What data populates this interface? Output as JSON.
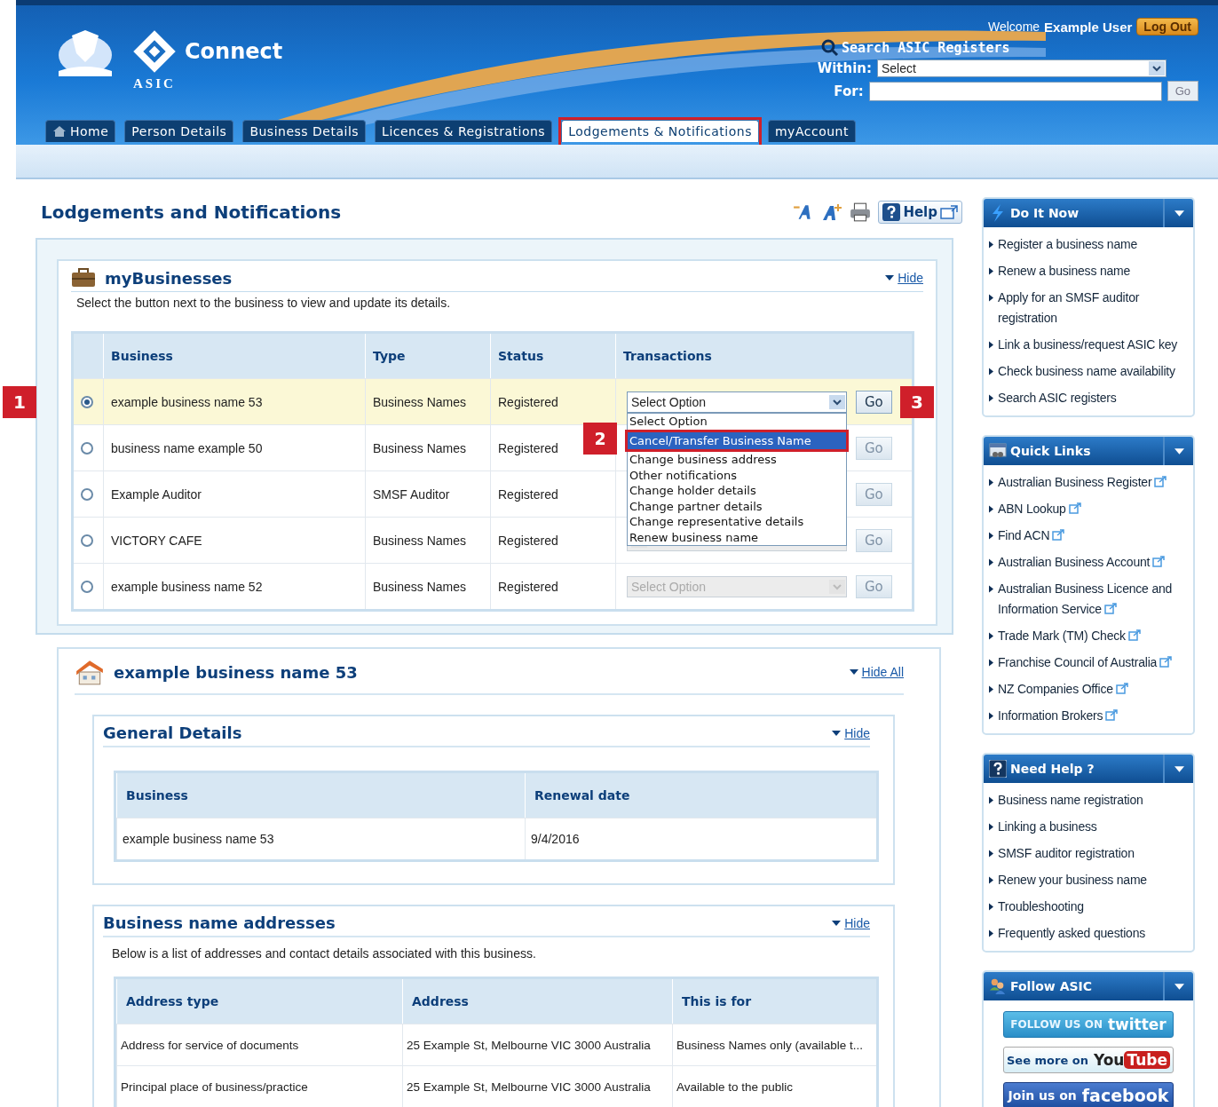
{
  "header": {
    "welcome": "Welcome",
    "user": "Example User",
    "logout": "Log Out",
    "logo": "Connect",
    "agency": "ASIC",
    "search": {
      "title": "Search ASIC Registers",
      "within_label": "Within:",
      "within_value": "Select",
      "for_label": "For:",
      "go": "Go"
    }
  },
  "tabs": [
    {
      "label": "Home",
      "kind": "home",
      "selected": false,
      "highlighted": false
    },
    {
      "label": "Person Details",
      "kind": "plain",
      "selected": false,
      "highlighted": false
    },
    {
      "label": "Business Details",
      "kind": "plain",
      "selected": false,
      "highlighted": false
    },
    {
      "label": "Licences & Registrations",
      "kind": "plain",
      "selected": false,
      "highlighted": false
    },
    {
      "label": "Lodgements & Notifications",
      "kind": "plain",
      "selected": true,
      "highlighted": true
    },
    {
      "label": "myAccount",
      "kind": "plain",
      "selected": false,
      "highlighted": false
    }
  ],
  "page_title": "Lodgements and Notifications",
  "help": "Help",
  "my_businesses": {
    "title": "myBusinesses",
    "hide": "Hide",
    "intro": "Select the button next to the business to view and update its details.",
    "columns": [
      "Business",
      "Type",
      "Status",
      "Transactions"
    ],
    "rows": [
      {
        "selected": true,
        "business": "example business name 53",
        "type": "Business Names",
        "status": "Registered",
        "select": true,
        "transaction": "Select Option",
        "go": "Go",
        "disabled": false,
        "callout": "1",
        "go_callout": "3"
      },
      {
        "selected": false,
        "business": "business name example 50",
        "type": "Business Names",
        "status": "Registered",
        "go": "Go",
        "disabled": true
      },
      {
        "selected": false,
        "business": "Example Auditor",
        "type": "SMSF Auditor",
        "status": "Registered",
        "go": "Go",
        "disabled": true
      },
      {
        "selected": false,
        "business": "VICTORY CAFE",
        "type": "Business Names",
        "status": "Registered",
        "select": true,
        "go": "Go",
        "disabled": true
      },
      {
        "selected": false,
        "business": "example business name 52",
        "type": "Business Names",
        "status": "Registered",
        "select": true,
        "transaction": "Select Option",
        "go": "Go",
        "disabled": true
      }
    ],
    "dropdown": [
      {
        "label": "Select Option",
        "selected": false,
        "highlighted": false
      },
      {
        "label": "Cancel/Transfer Business Name",
        "selected": true,
        "highlighted": true,
        "callout": "2"
      },
      {
        "label": "Change business address",
        "selected": false,
        "highlighted": false
      },
      {
        "label": "Other notifications",
        "selected": false,
        "highlighted": false
      },
      {
        "label": "Change holder details",
        "selected": false,
        "highlighted": false
      },
      {
        "label": "Change partner details",
        "selected": false,
        "highlighted": false
      },
      {
        "label": "Change representative details",
        "selected": false,
        "highlighted": false
      },
      {
        "label": "Renew business name",
        "selected": false,
        "highlighted": false
      }
    ]
  },
  "business_detail": {
    "title": "example business name 53",
    "hide_all": "Hide All",
    "general": {
      "title": "General Details",
      "hide": "Hide",
      "columns": [
        "Business",
        "Renewal date"
      ],
      "rows": [
        [
          "example business name 53",
          "9/4/2016"
        ]
      ]
    },
    "addresses": {
      "title": "Business name addresses",
      "hide": "Hide",
      "intro": "Below is a list of addresses and contact details associated with this business.",
      "columns": [
        "Address type",
        "Address",
        "This is for"
      ],
      "rows": [
        [
          "Address for service of documents",
          "25 Example St, Melbourne VIC 3000 Australia",
          "Business Names only (available t..."
        ],
        [
          "Principal place of business/practice",
          "25 Example St, Melbourne VIC 3000 Australia",
          "Available to the public"
        ]
      ]
    }
  },
  "sidebar": [
    {
      "title": "Do It Now",
      "kind": "lightning",
      "items": [
        {
          "label": "Register a business name",
          "external": false
        },
        {
          "label": "Renew a business name",
          "external": false
        },
        {
          "label": "Apply for an SMSF auditor registration",
          "external": false
        },
        {
          "label": "Link a business/request ASIC key",
          "external": false
        },
        {
          "label": "Check business name availability",
          "external": false
        },
        {
          "label": "Search ASIC registers",
          "external": false
        }
      ]
    },
    {
      "title": "Quick Links",
      "kind": "window",
      "items": [
        {
          "label": "Australian Business Register",
          "external": true
        },
        {
          "label": "ABN Lookup",
          "external": true
        },
        {
          "label": "Find ACN",
          "external": true
        },
        {
          "label": "Australian Business Account",
          "external": true
        },
        {
          "label": "Australian Business Licence and Information Service",
          "external": true
        },
        {
          "label": "Trade Mark (TM) Check",
          "external": true
        },
        {
          "label": "Franchise Council of Australia",
          "external": true
        },
        {
          "label": "NZ Companies Office",
          "external": true
        },
        {
          "label": "Information Brokers",
          "external": true
        }
      ]
    },
    {
      "title": "Need Help ?",
      "kind": "question",
      "items": [
        {
          "label": "Business name registration",
          "external": false
        },
        {
          "label": "Linking a business",
          "external": false
        },
        {
          "label": "SMSF auditor registration",
          "external": false
        },
        {
          "label": "Renew your business name",
          "external": false
        },
        {
          "label": "Troubleshooting",
          "external": false
        },
        {
          "label": "Frequently asked questions",
          "external": false
        }
      ]
    },
    {
      "title": "Follow ASIC",
      "kind": "people",
      "social": [
        {
          "kind": "twitter",
          "lead": "FOLLOW US ON",
          "brand": "twitter"
        },
        {
          "kind": "youtube",
          "lead": "See more on",
          "brand": "You",
          "brand_box": "Tube"
        },
        {
          "kind": "facebook",
          "lead": "Join us on",
          "brand": "facebook"
        }
      ]
    }
  ]
}
